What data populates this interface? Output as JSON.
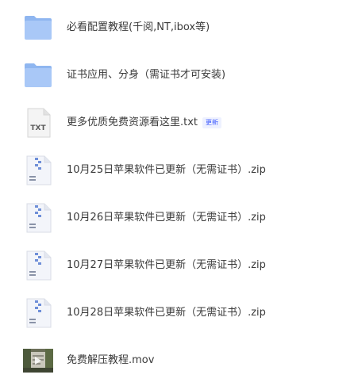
{
  "files": [
    {
      "name": "必看配置教程(千阅,NT,ibox等)",
      "type": "folder",
      "icon": "folder-icon"
    },
    {
      "name": "证书应用、分身（需证书才可安装)",
      "type": "folder",
      "icon": "folder-icon"
    },
    {
      "name": "更多优质免费资源看这里.txt",
      "type": "txt",
      "icon": "txt-file-icon",
      "badge": "更新",
      "icon_label": "TXT"
    },
    {
      "name": "10月25日苹果软件已更新（无需证书）.zip",
      "type": "zip",
      "icon": "zip-file-icon"
    },
    {
      "name": "10月26日苹果软件已更新（无需证书）.zip",
      "type": "zip",
      "icon": "zip-file-icon"
    },
    {
      "name": "10月27日苹果软件已更新（无需证书）.zip",
      "type": "zip",
      "icon": "zip-file-icon"
    },
    {
      "name": "10月28日苹果软件已更新（无需证书）.zip",
      "type": "zip",
      "icon": "zip-file-icon"
    },
    {
      "name": "免费解压教程.mov",
      "type": "video",
      "icon": "video-thumbnail-icon"
    }
  ],
  "colors": {
    "folder_back": "#8fb6f0",
    "folder_front": "#a9c8f7",
    "zip_stripe": "#6f8fd8",
    "badge_text": "#3d5afe",
    "badge_bg": "#eef1ff"
  }
}
